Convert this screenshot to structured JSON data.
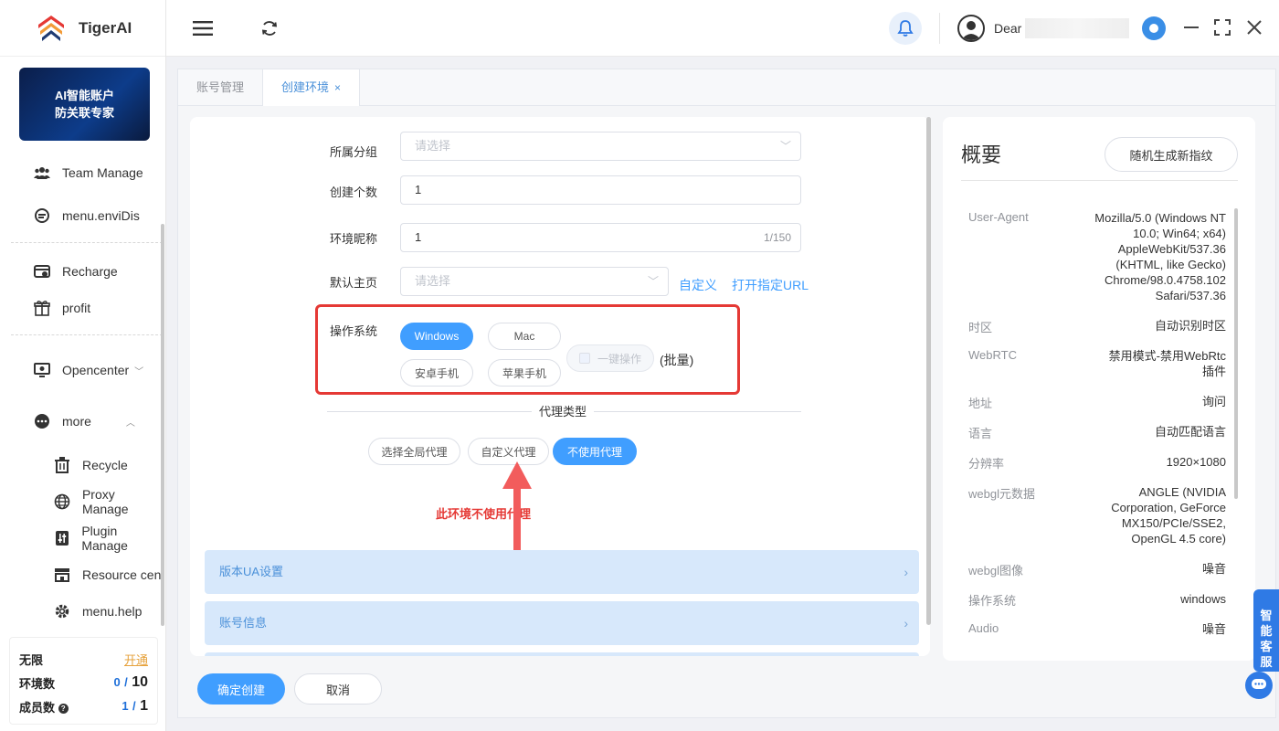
{
  "app": {
    "name": "TigerAI",
    "banner_line1": "AI智能账户",
    "banner_line2": "防关联专家"
  },
  "sidebar": {
    "items": [
      {
        "label": "Team Manage",
        "icon": "team-icon"
      },
      {
        "label": "menu.enviDis",
        "icon": "env-icon"
      },
      {
        "label": "Recharge",
        "icon": "recharge-icon"
      },
      {
        "label": "profit",
        "icon": "gift-icon"
      },
      {
        "label": "Opencenter",
        "icon": "open-icon"
      },
      {
        "label": "more",
        "icon": "more-icon"
      },
      {
        "label": "Recycle",
        "icon": "trash-icon"
      },
      {
        "label": "Proxy Manage",
        "icon": "globe-icon"
      },
      {
        "label": "Plugin Manage",
        "icon": "plugin-icon"
      },
      {
        "label": "Resource cen",
        "icon": "store-icon"
      },
      {
        "label": "menu.help",
        "icon": "gear-icon"
      }
    ],
    "quota": {
      "plan": "无限",
      "open": "开通",
      "env_label": "环境数",
      "env_used": "0",
      "env_sep": "/",
      "env_total": "10",
      "member_label": "成员数",
      "member_used": "1",
      "member_sep": "/",
      "member_total": "1"
    }
  },
  "header": {
    "user_prefix": "Dear"
  },
  "tabs": [
    {
      "label": "账号管理"
    },
    {
      "label": "创建环境",
      "close": "×"
    }
  ],
  "form": {
    "group_label": "所属分组",
    "group_placeholder": "请选择",
    "count_label": "创建个数",
    "count_value": "1",
    "nickname_label": "环境昵称",
    "nickname_value": "1",
    "nickname_counter": "1/150",
    "homepage_label": "默认主页",
    "homepage_placeholder": "请选择",
    "homepage_custom": "自定义",
    "homepage_url": "打开指定URL",
    "os_label": "操作系统",
    "os_options": [
      "Windows",
      "Mac",
      "安卓手机",
      "苹果手机"
    ],
    "os_selected": "Windows",
    "batch_check": "一键操作",
    "batch_label": "(批量)",
    "proxy_title": "代理类型",
    "proxy_options": [
      "选择全局代理",
      "自定义代理",
      "不使用代理"
    ],
    "proxy_selected": "不使用代理",
    "proxy_note": "此环境不使用代理",
    "sections": [
      "版本UA设置",
      "账号信息"
    ],
    "submit": "确定创建",
    "cancel": "取消"
  },
  "summary": {
    "title": "概要",
    "regen_button": "随机生成新指纹",
    "rows": [
      {
        "key": "User-Agent",
        "value": "Mozilla/5.0 (Windows NT 10.0; Win64; x64) AppleWebKit/537.36 (KHTML, like Gecko) Chrome/98.0.4758.102 Safari/537.36"
      },
      {
        "key": "时区",
        "value": "自动识别时区"
      },
      {
        "key": "WebRTC",
        "value": "禁用模式-禁用WebRtc插件"
      },
      {
        "key": "地址",
        "value": "询问"
      },
      {
        "key": "语言",
        "value": "自动匹配语言"
      },
      {
        "key": "分辨率",
        "value": "1920×1080"
      },
      {
        "key": "webgl元数据",
        "value": "ANGLE (NVIDIA Corporation, GeForce MX150/PCIe/SSE2, OpenGL 4.5 core)"
      },
      {
        "key": "webgl图像",
        "value": "噪音"
      },
      {
        "key": "操作系统",
        "value": "windows"
      },
      {
        "key": "Audio",
        "value": "噪音"
      }
    ]
  },
  "support": {
    "label": "智能客服"
  }
}
